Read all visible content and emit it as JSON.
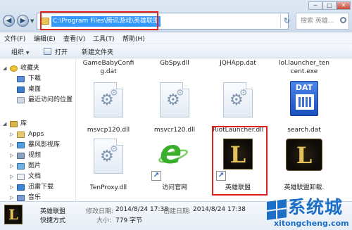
{
  "window": {
    "minimize_label": "─",
    "maximize_label": "□",
    "close_label": "✕"
  },
  "address_bar": {
    "path": "C:\\Program Files\\腾讯游戏\\英雄联盟",
    "refresh_label": "↻",
    "search_placeholder": "搜索 英雄...",
    "highlight_color": "#e0201a"
  },
  "nav_buttons": {
    "back_label": "◀",
    "forward_label": "▶",
    "dropdown_label": "▼"
  },
  "menu": {
    "items": [
      "文件(F)",
      "编辑(E)",
      "查看(V)",
      "工具(T)",
      "帮助(H)"
    ]
  },
  "toolbar": {
    "organize_label": "组织",
    "open_label": "打开",
    "new_folder_label": "新建文件夹",
    "caret": "▼"
  },
  "sidebar": {
    "favorites_label": "收藏夹",
    "favorites": [
      "下载",
      "桌面",
      "最近访问的位置"
    ],
    "libraries_label": "库",
    "libraries": [
      "Apps",
      "暴风影视库",
      "视频",
      "图片",
      "文档",
      "迅雷下载",
      "音乐"
    ],
    "expand_symbol": "◢",
    "collapsed_symbol": "▷"
  },
  "files": {
    "top_row": [
      "GameBabyConfig.dat",
      "GbSpy.dll",
      "JQHApp.dat",
      "lol.launcher_tencent.exe"
    ],
    "top_row_wrapped": [
      [
        "GameBabyConfi",
        "g.dat"
      ],
      [
        "GbSpy.dll"
      ],
      [
        "JQHApp.dat"
      ],
      [
        "lol.launcher_ten",
        "cent.exe"
      ]
    ],
    "row2": [
      {
        "name": "msvcp120.dll",
        "icon": "gear-file-icon"
      },
      {
        "name": "msvcr120.dll",
        "icon": "gear-file-icon"
      },
      {
        "name": "RiotLauncher.dll",
        "icon": "gear-file-icon"
      },
      {
        "name": "search.dat",
        "icon": "dat-file-icon"
      }
    ],
    "row3": [
      {
        "name": "TenProxy.dll",
        "icon": "gear-file-icon"
      },
      {
        "name": "访问官网",
        "icon": "ie-shortcut-icon"
      },
      {
        "name": "英雄联盟",
        "icon": "lol-shortcut-icon"
      },
      {
        "name": "英雄联盟卸载.",
        "icon": "lol-uninstall-icon"
      }
    ],
    "dat_label": "DAT",
    "lol_letter": "L",
    "shortcut_arrow": "↗"
  },
  "details": {
    "name": "英雄联盟",
    "type": "快捷方式",
    "modified_key": "修改日期:",
    "modified_value": "2014/8/24 17:38",
    "created_key": "创建日期:",
    "created_value": "2014/8/24 17:38",
    "size_key": "大小:",
    "size_value": "779 字节"
  },
  "watermark": {
    "text": "系统城",
    "url": "xitongcheng.com"
  }
}
